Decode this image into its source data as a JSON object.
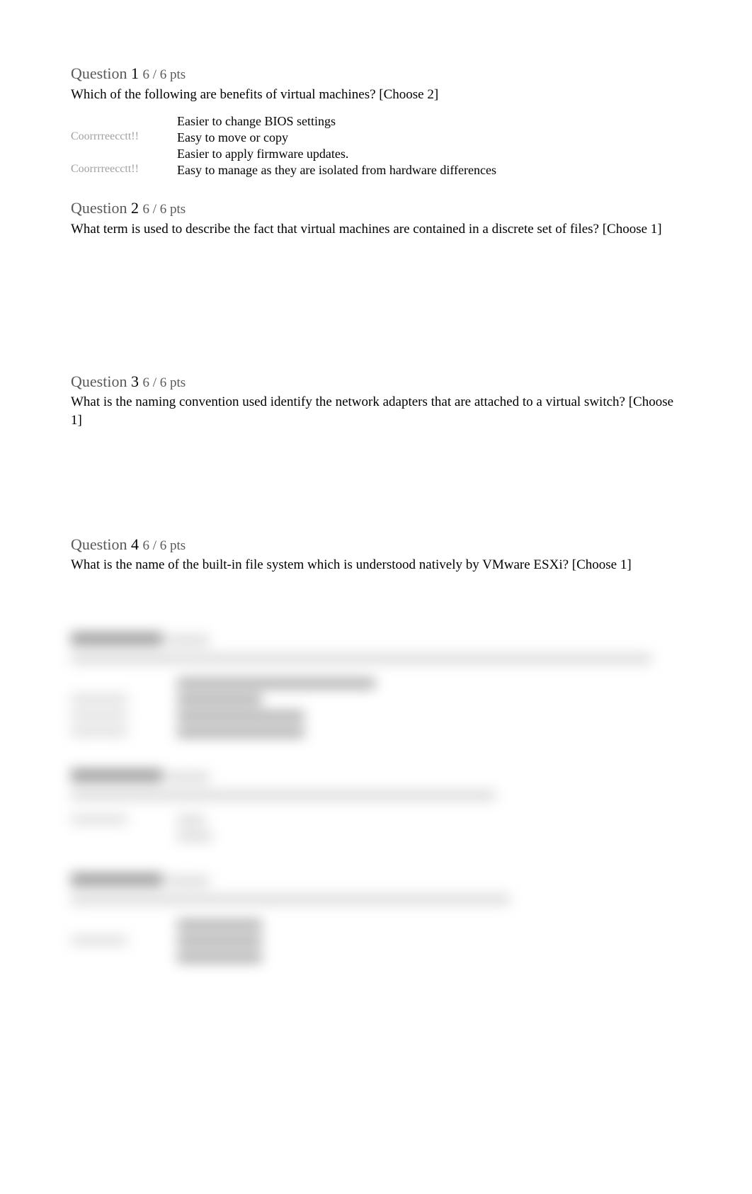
{
  "questions": [
    {
      "label": "Question",
      "number": "1",
      "points": "6 / 6 pts",
      "text": "Which of the following are benefits of virtual machines? [Choose 2]",
      "answers": [
        {
          "indicator": "",
          "text": "Easier to change BIOS settings"
        },
        {
          "indicator": "Coorrrreecctt!!",
          "text": "Easy to move or copy"
        },
        {
          "indicator": "",
          "text": "Easier to apply firmware updates."
        },
        {
          "indicator": "Coorrrreecctt!!",
          "text": "Easy to manage as they are isolated from hardware differences"
        }
      ],
      "spacer": "none"
    },
    {
      "label": "Question",
      "number": "2",
      "points": "6 / 6 pts",
      "text": "What term is used to describe the fact that virtual machines are contained in a discrete set of files? [Choose 1]",
      "answers": [],
      "spacer": "large"
    },
    {
      "label": "Question",
      "number": "3",
      "points": "6 / 6 pts",
      "text": "What is the naming convention used identify the network adapters that are attached to a virtual switch? [Choose 1]",
      "answers": [],
      "spacer": "medium"
    },
    {
      "label": "Question",
      "number": "4",
      "points": "6 / 6 pts",
      "text": "What is the name of the built-in file system which is understood natively by VMware ESXi? [Choose 1]",
      "answers": [],
      "spacer": "none"
    }
  ]
}
